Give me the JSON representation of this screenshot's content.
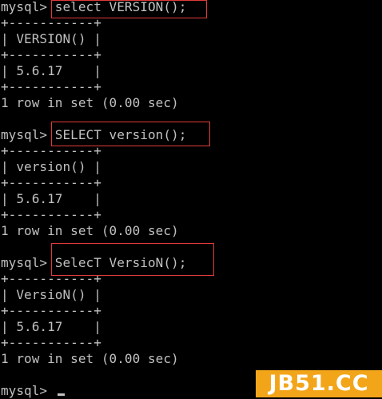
{
  "terminal": {
    "lines": [
      "mysql> select VERSION();",
      "+-----------+",
      "| VERSION() |",
      "+-----------+",
      "| 5.6.17    |",
      "+-----------+",
      "1 row in set (0.00 sec)",
      "",
      "mysql> SELECT version();",
      "+-----------+",
      "| version() |",
      "+-----------+",
      "| 5.6.17    |",
      "+-----------+",
      "1 row in set (0.00 sec)",
      "",
      "mysql> SelecT VersioN();",
      "+-----------+",
      "| VersioN() |",
      "+-----------+",
      "| 5.6.17    |",
      "+-----------+",
      "1 row in set (0.00 sec)",
      "",
      "mysql> "
    ]
  },
  "watermark": {
    "text": "JB51.CC"
  },
  "colors": {
    "background": "#000000",
    "text": "#c0c0c0",
    "highlight_border": "#e03a3a",
    "watermark_bg": "#f3a51a",
    "watermark_text": "#ffffff"
  }
}
